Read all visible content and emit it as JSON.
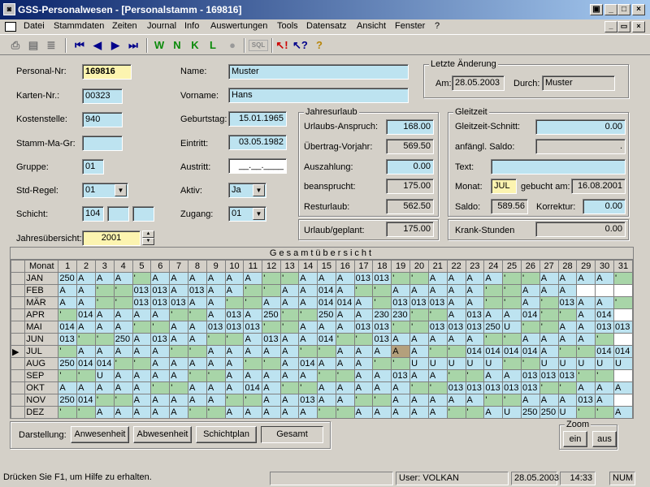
{
  "window": {
    "title": "GSS-Personalwesen - [Personalstamm - 169816]",
    "app_icon": "app-icon"
  },
  "menu": [
    "Datei",
    "Stammdaten",
    "Zeiten",
    "Journal",
    "Info",
    "Auswertungen",
    "Tools",
    "Datensatz",
    "Ansicht",
    "Fenster",
    "?"
  ],
  "toolbar": {
    "w": "W",
    "n": "N",
    "k": "K",
    "l": "L",
    "sql": "SQL"
  },
  "form": {
    "personal_nr_label": "Personal-Nr:",
    "personal_nr": "169816",
    "karten_nr_label": "Karten-Nr.:",
    "karten_nr": "00323",
    "kostenstelle_label": "Kostenstelle:",
    "kostenstelle": "940",
    "stamm_ma_gr_label": "Stamm-Ma-Gr:",
    "stamm_ma_gr": "",
    "gruppe_label": "Gruppe:",
    "gruppe": "01",
    "std_regel_label": "Std-Regel:",
    "std_regel": "01",
    "schicht_label": "Schicht:",
    "schicht1": "104",
    "schicht2": "",
    "schicht3": "",
    "jahresuebersicht_label": "Jahresübersicht:",
    "jahr": "2001",
    "name_label": "Name:",
    "name": "Muster",
    "vorname_label": "Vorname:",
    "vorname": "Hans",
    "geburtstag_label": "Geburtstag:",
    "geburtstag": "15.01.1965",
    "eintritt_label": "Eintritt:",
    "eintritt": "03.05.1982",
    "austritt_label": "Austritt:",
    "austritt": "__.__.____",
    "aktiv_label": "Aktiv:",
    "aktiv": "Ja",
    "zugang_label": "Zugang:",
    "zugang": "01"
  },
  "letzte_aenderung": {
    "title": "Letzte Änderung",
    "am_label": "Am:",
    "am": "28.05.2003",
    "durch_label": "Durch:",
    "durch": "Muster"
  },
  "jahresurlaub": {
    "title": "Jahresurlaub",
    "anspruch_label": "Urlaubs-Anspruch:",
    "anspruch": "168.00",
    "uebertrag_label": "Übertrag-Vorjahr:",
    "uebertrag": "569.50",
    "auszahlung_label": "Auszahlung:",
    "auszahlung": "0.00",
    "beansprucht_label": "beansprucht:",
    "beansprucht": "175.00",
    "resturlaub_label": "Resturlaub:",
    "resturlaub": "562.50",
    "geplant_label": "Urlaub/geplant:",
    "geplant": "175.00"
  },
  "gleitzeit": {
    "title": "Gleitzeit",
    "schnitt_label": "Gleitzeit-Schnitt:",
    "schnitt": "0.00",
    "saldo_anf_label": "anfängl. Saldo:",
    "saldo_anf": ".",
    "text_label": "Text:",
    "text": "",
    "monat_label": "Monat:",
    "monat": "JUL",
    "gebucht_label": "gebucht am:",
    "gebucht": "16.08.2001",
    "saldo_label": "Saldo:",
    "saldo": "589.56",
    "korrektur_label": "Korrektur:",
    "korrektur": "0.00",
    "krank_label": "Krank-Stunden",
    "krank": "0.00"
  },
  "grid": {
    "title": "Gesamtübersicht",
    "month_header": "Monat",
    "current_row": 6,
    "selected_cell": [
      6,
      19
    ],
    "colors": {
      "blue": "#bde3f0",
      "green": "#a8d5a8",
      "selected": "#b4a07c"
    },
    "rows": [
      {
        "m": "JAN",
        "c": [
          "250",
          "A",
          "A",
          "A",
          "'",
          "A",
          "A",
          "A",
          "A",
          "A",
          "A",
          "'",
          "'",
          "A",
          "A",
          "A",
          "013",
          "013",
          "'",
          "'",
          "A",
          "A",
          "A",
          "A",
          "'",
          "'",
          "A",
          "A",
          "A",
          "A",
          "'"
        ]
      },
      {
        "m": "FEB",
        "c": [
          "A",
          "A",
          "'",
          "'",
          "013",
          "013",
          "A",
          "013",
          "A",
          "A",
          "'",
          "'",
          "A",
          "A",
          "014",
          "A",
          "'",
          "'",
          "A",
          "A",
          "A",
          "A",
          "A",
          "'",
          "'",
          "A",
          "A",
          "A",
          "",
          "",
          ""
        ]
      },
      {
        "m": "MÄR",
        "c": [
          "A",
          "A",
          "'",
          "'",
          "013",
          "013",
          "013",
          "A",
          "A",
          "'",
          "'",
          "A",
          "A",
          "A",
          "014",
          "014",
          "A",
          "'",
          "013",
          "013",
          "013",
          "A",
          "A",
          "'",
          "'",
          "A",
          "'",
          "013",
          "A",
          "A",
          "'"
        ]
      },
      {
        "m": "APR",
        "c": [
          "'",
          "014",
          "A",
          "A",
          "A",
          "A",
          "'",
          "'",
          "A",
          "013",
          "A",
          "250",
          "'",
          "'",
          "250",
          "A",
          "A",
          "230",
          "230",
          "'",
          "'",
          "A",
          "013",
          "A",
          "A",
          "014",
          "'",
          "'",
          "A",
          "014",
          ""
        ]
      },
      {
        "m": "MAI",
        "c": [
          "014",
          "A",
          "A",
          "A",
          "'",
          "'",
          "A",
          "A",
          "013",
          "013",
          "013",
          "'",
          "'",
          "A",
          "A",
          "A",
          "013",
          "013",
          "'",
          "'",
          "013",
          "013",
          "013",
          "250",
          "U",
          "'",
          "'",
          "A",
          "A",
          "013",
          "013"
        ]
      },
      {
        "m": "JUN",
        "c": [
          "013",
          "'",
          "'",
          "250",
          "A",
          "013",
          "A",
          "A",
          "'",
          "'",
          "A",
          "013",
          "A",
          "A",
          "014",
          "'",
          "'",
          "013",
          "A",
          "A",
          "A",
          "A",
          "A",
          "'",
          "'",
          "A",
          "A",
          "A",
          "A",
          "'",
          ""
        ]
      },
      {
        "m": "JUL",
        "c": [
          "'",
          "A",
          "A",
          "A",
          "A",
          "A",
          "'",
          "'",
          "A",
          "A",
          "A",
          "A",
          "A",
          "'",
          "'",
          "A",
          "A",
          "A",
          "A",
          "A",
          "'",
          "'",
          "014",
          "014",
          "014",
          "014",
          "A",
          "'",
          "'",
          "014",
          "014"
        ]
      },
      {
        "m": "AUG",
        "c": [
          "250",
          "014",
          "014",
          "'",
          "'",
          "A",
          "A",
          "A",
          "A",
          "A",
          "'",
          "'",
          "A",
          "014",
          "A",
          "A",
          "A",
          "'",
          "'",
          "U",
          "U",
          "U",
          "U",
          "U",
          "'",
          "'",
          "U",
          "U",
          "U",
          "U",
          "U"
        ]
      },
      {
        "m": "SEP",
        "c": [
          "'",
          "'",
          "U",
          "A",
          "A",
          "A",
          "A",
          "'",
          "'",
          "A",
          "A",
          "A",
          "A",
          "A",
          "'",
          "'",
          "A",
          "A",
          "013",
          "A",
          "A",
          "'",
          "'",
          "A",
          "A",
          "013",
          "013",
          "013",
          "'",
          "'",
          ""
        ]
      },
      {
        "m": "OKT",
        "c": [
          "A",
          "A",
          "A",
          "A",
          "A",
          "'",
          "'",
          "A",
          "A",
          "A",
          "014",
          "A",
          "'",
          "'",
          "A",
          "A",
          "A",
          "A",
          "A",
          "'",
          "'",
          "013",
          "013",
          "013",
          "013",
          "013",
          "'",
          "'",
          "A",
          "A",
          "A"
        ]
      },
      {
        "m": "NOV",
        "c": [
          "250",
          "014",
          "'",
          "'",
          "A",
          "A",
          "A",
          "A",
          "A",
          "'",
          "'",
          "A",
          "A",
          "013",
          "A",
          "A",
          "'",
          "'",
          "A",
          "A",
          "A",
          "A",
          "A",
          "'",
          "'",
          "A",
          "A",
          "A",
          "013",
          "A",
          ""
        ]
      },
      {
        "m": "DEZ",
        "c": [
          "'",
          "'",
          "A",
          "A",
          "A",
          "A",
          "A",
          "'",
          "'",
          "A",
          "A",
          "A",
          "A",
          "A",
          "'",
          "'",
          "A",
          "A",
          "A",
          "A",
          "A",
          "'",
          "'",
          "A",
          "U",
          "250",
          "250",
          "U",
          "'",
          "'",
          "A"
        ]
      }
    ]
  },
  "darstellung": {
    "label": "Darstellung:",
    "buttons": [
      "Anwesenheit",
      "Abwesenheit",
      "Schichtplan",
      "Gesamt"
    ],
    "selected": "Gesamt"
  },
  "zoom": {
    "title": "Zoom",
    "in": "ein",
    "out": "aus"
  },
  "status": {
    "help": "Drücken Sie F1, um Hilfe zu erhalten.",
    "user": "User: VOLKAN",
    "date": "28.05.2003",
    "time": "14:33",
    "num": "NUM"
  }
}
